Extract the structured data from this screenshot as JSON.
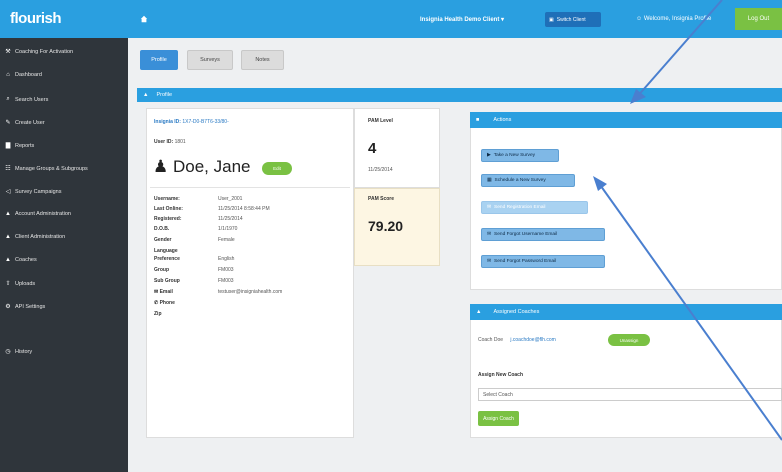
{
  "app": {
    "logo": "flourish"
  },
  "header": {
    "org_name": "Insignia Health Demo Client ▾",
    "switch_client": "Switch Client",
    "welcome": "Welcome, Insignia Profile",
    "logout": "Log Out"
  },
  "sidebar": {
    "items": [
      {
        "label": "Coaching For Activation",
        "icon": "wrench"
      },
      {
        "label": "Dashboard",
        "icon": "home"
      },
      {
        "label": "Search Users",
        "icon": "search"
      },
      {
        "label": "Create User",
        "icon": "edit"
      },
      {
        "label": "Reports",
        "icon": "bar-chart"
      },
      {
        "label": "Manage Groups & Subgroups",
        "icon": "sitemap"
      },
      {
        "label": "Survey Campaigns",
        "icon": "bullhorn"
      },
      {
        "label": "Account Administration",
        "icon": "user"
      },
      {
        "label": "Client Administration",
        "icon": "user"
      },
      {
        "label": "Coaches",
        "icon": "user"
      },
      {
        "label": "Uploads",
        "icon": "upload"
      },
      {
        "label": "API Settings",
        "icon": "gear"
      },
      {
        "label": "History",
        "icon": "history"
      }
    ]
  },
  "tabs": [
    {
      "label": "Profile",
      "active": true
    },
    {
      "label": "Surveys",
      "active": false
    },
    {
      "label": "Notes",
      "active": false
    }
  ],
  "profile": {
    "section_title": "Profile",
    "insignia_id_label": "Insignia ID:",
    "insignia_id": "1X7-D0-B7T6-33/80-",
    "user_id_label": "User ID:",
    "user_id": "1801",
    "name": "Doe, Jane",
    "status_badge": "Edit",
    "fields": [
      {
        "label": "Username:",
        "value": "User_2001"
      },
      {
        "label": "Last Online:",
        "value": "11/25/2014 8:58:44 PM"
      },
      {
        "label": "Registered:",
        "value": "11/25/2014"
      },
      {
        "label": "D.O.B.",
        "value": "1/1/1970"
      },
      {
        "label": "Gender",
        "value": "Female"
      },
      {
        "label": "Language",
        "value": ""
      },
      {
        "label": "Preference",
        "value": "English"
      },
      {
        "label": "Group",
        "value": "FM003"
      },
      {
        "label": "Sub Group",
        "value": "FM003"
      },
      {
        "label": "Email",
        "value": "testuser@insigniahealth.com"
      },
      {
        "label": "Phone",
        "value": ""
      },
      {
        "label": "Zip",
        "value": ""
      }
    ]
  },
  "pam": {
    "level_label": "PAM Level",
    "level": "4",
    "level_date": "11/25/2014",
    "score_label": "PAM Score",
    "score": "79.20"
  },
  "actions": {
    "title": "Actions",
    "buttons": [
      {
        "label": "Take a New Survey",
        "style": "dark"
      },
      {
        "label": "Schedule a New Survey",
        "style": "dark"
      },
      {
        "label": "Send Registration Email",
        "style": "light"
      },
      {
        "label": "Send Forgot Username Email",
        "style": "dark"
      },
      {
        "label": "Send Forgot Password Email",
        "style": "dark"
      }
    ]
  },
  "coaches": {
    "title": "Assigned Coaches",
    "coach_label": "Coach Doe",
    "coach_email": "j.coachdoe@flh.com",
    "unassign": "Unassign",
    "assign_label": "Assign New Coach",
    "select_placeholder": "Select Coach",
    "assign_button": "Assign Coach"
  },
  "colors": {
    "brand_blue": "#2a9fe0",
    "sidebar": "#2f353b",
    "green": "#7ac143"
  }
}
